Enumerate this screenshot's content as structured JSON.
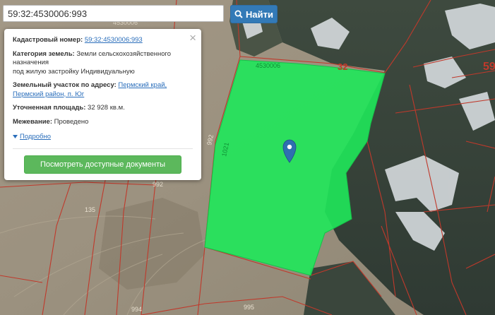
{
  "search": {
    "value": "59:32:4530006:993",
    "button_label": "Найти",
    "button_icon": "search-icon"
  },
  "popup": {
    "close_glyph": "×",
    "cadastral_label": "Кадастровый номер:",
    "cadastral_value": "59:32:4530006:993",
    "category_label": "Категория земель:",
    "category_value_line1": "Земли сельскохозяйственного",
    "category_value_line2": "назначения",
    "category_value_line3": "под жилую застройку Индивидуальную",
    "address_label": "Земельный участок по адресу:",
    "address_value_line1": "Пермский край,",
    "address_value_line2": "Пермский район, п. Юг",
    "area_label": "Уточненная площадь:",
    "area_value": "32 928 кв.м.",
    "survey_label": "Межевание:",
    "survey_value": "Проведено",
    "more_label": "Подробно",
    "documents_button": "Посмотреть доступные документы"
  },
  "map": {
    "parcel_color": "#1fe85a",
    "boundary_color": "#c0392b",
    "marker_color": "#2f6fb0",
    "labels": {
      "quarter_top": "4530006",
      "parcel_top": "4530006",
      "n32": "32",
      "n59": "59",
      "n992": "992",
      "n1021": "1021",
      "n992b": "992",
      "n135": "135",
      "n994": "994",
      "n995": "995"
    }
  }
}
